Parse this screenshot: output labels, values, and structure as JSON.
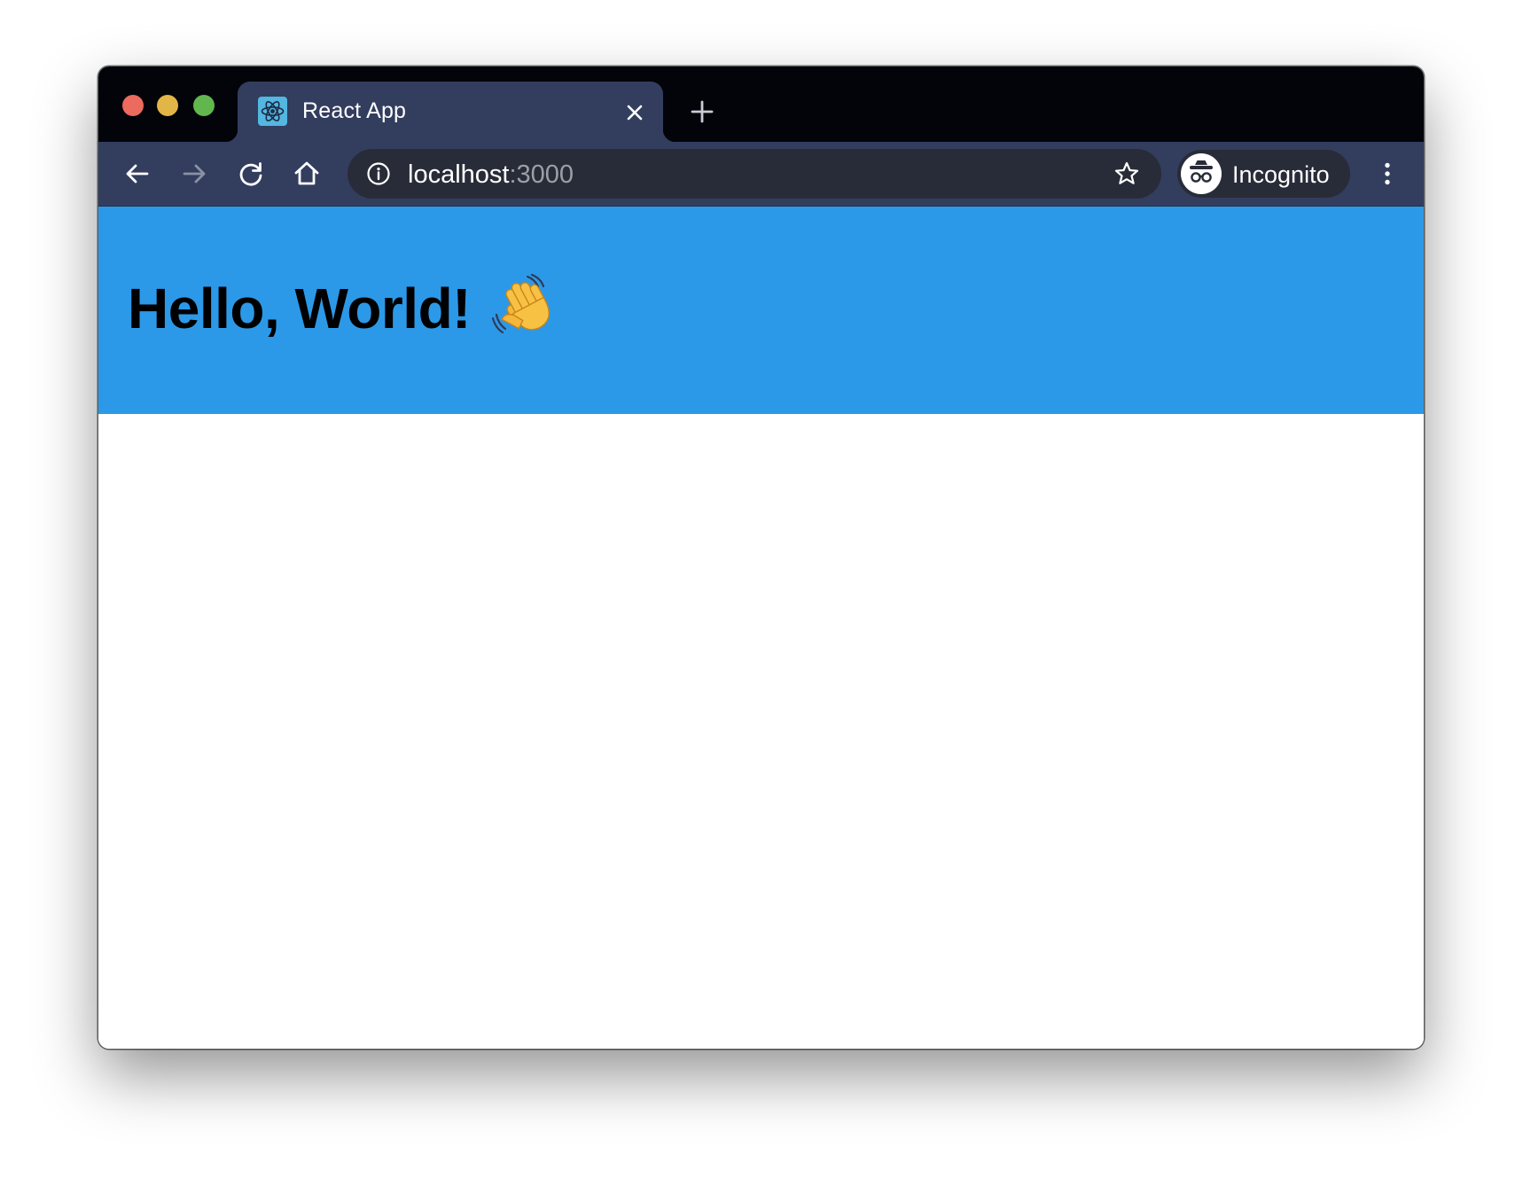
{
  "browser": {
    "colors": {
      "titlebar": "#030409",
      "tab_active": "#333d5e",
      "toolbar": "#333d5e",
      "omnibox": "#282c38",
      "close_dot": "#ec6a5e",
      "minimize_dot": "#e2b547",
      "zoom_dot": "#62b64e"
    },
    "window_controls": [
      "close",
      "minimize",
      "zoom"
    ],
    "tabs": [
      {
        "title": "React App",
        "favicon": "react-logo-icon",
        "active": true
      }
    ],
    "new_tab_icon": "plus-icon",
    "toolbar": {
      "back_icon": "arrow-left-icon",
      "forward_icon": "arrow-right-icon",
      "forward_enabled": false,
      "reload_icon": "reload-icon",
      "home_icon": "home-icon"
    },
    "address_bar": {
      "info_icon": "info-icon",
      "host": "localhost",
      "port": ":3000",
      "bookmark_icon": "star-icon"
    },
    "profile": {
      "label": "Incognito",
      "icon": "incognito-icon"
    },
    "menu_icon": "kebab-menu-icon"
  },
  "page": {
    "header": {
      "background": "#2c99e8",
      "heading": "Hello, World!",
      "emoji_icon": "waving-hand-icon"
    }
  }
}
